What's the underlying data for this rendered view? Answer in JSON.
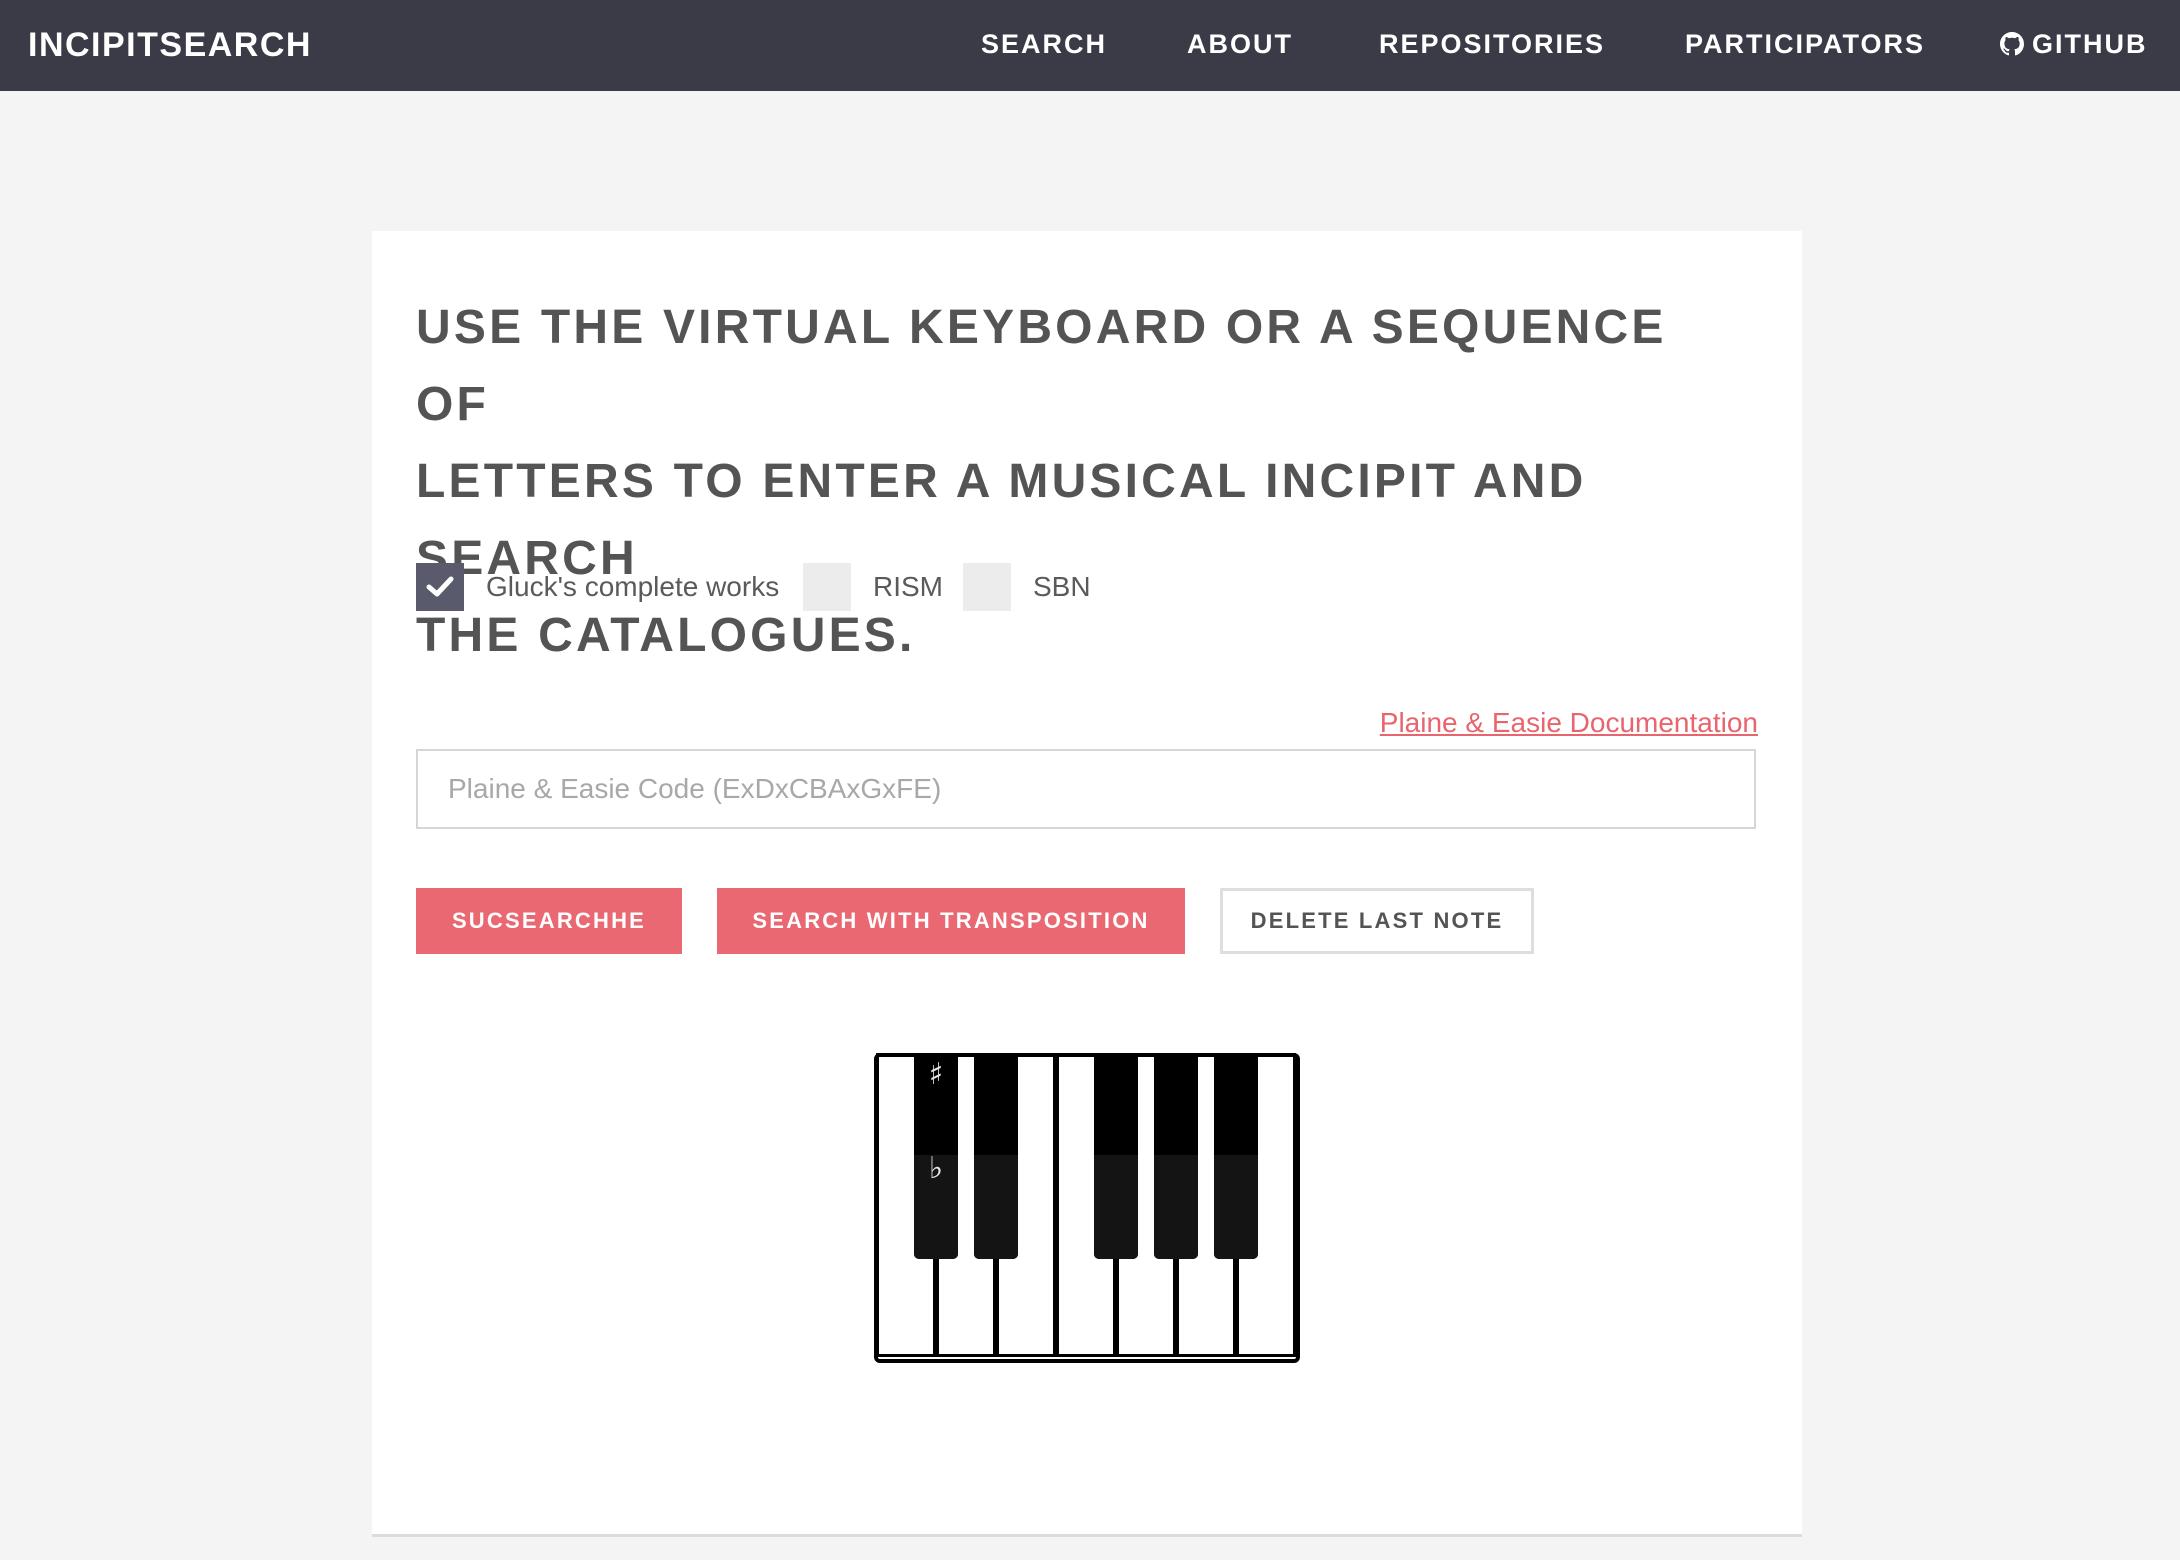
{
  "navbar": {
    "brand": "INCIPITSEARCH",
    "items": [
      {
        "label": "SEARCH"
      },
      {
        "label": "ABOUT"
      },
      {
        "label": "REPOSITORIES"
      },
      {
        "label": "PARTICIPATORS"
      },
      {
        "label": "GITHUB",
        "icon": "github-icon"
      }
    ],
    "background": "#3a3b46"
  },
  "main": {
    "headline_lines": [
      "USE THE VIRTUAL KEYBOARD OR A SEQUENCE OF",
      "LETTERS TO ENTER A MUSICAL INCIPIT AND SEARCH",
      "THE CATALOGUES."
    ],
    "catalogues": [
      {
        "label": "Gluck's complete works",
        "checked": true
      },
      {
        "label": "RISM",
        "checked": false
      },
      {
        "label": "SBN",
        "checked": false
      }
    ],
    "doc_link": "Plaine & Easie Documentation",
    "code_input": {
      "value": "",
      "placeholder": "Plaine & Easie Code (ExDxCBAxGxFE)"
    },
    "buttons": {
      "search": "SUCSEARCHHE",
      "search_transposition": "SEARCH WITH TRANSPOSITION",
      "delete_last": "DELETE LAST NOTE"
    },
    "keyboard": {
      "white_key_count": 7,
      "black_key_count": 5,
      "sharp_symbol": "♯",
      "flat_symbol": "♭"
    }
  },
  "colors": {
    "accent": "#ea6871",
    "checkbox_checked": "#595a6b",
    "text": "#545454",
    "page_bg": "#f4f4f4"
  }
}
